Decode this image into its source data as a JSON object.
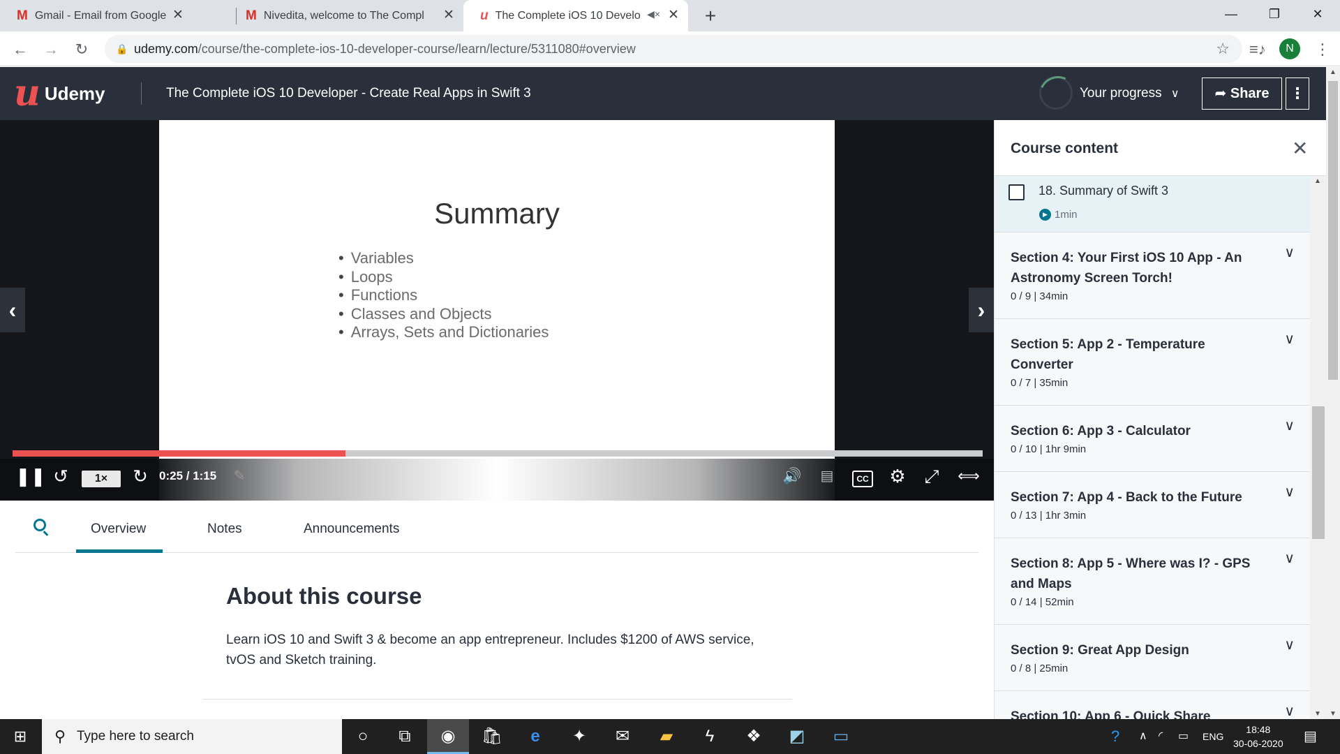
{
  "browser": {
    "tabs": [
      {
        "icon": "gmail-icon",
        "title": "Gmail - Email from Google",
        "active": false
      },
      {
        "icon": "gmail-icon",
        "title": "Nivedita, welcome to The Compl",
        "active": false
      },
      {
        "icon": "udemy-icon",
        "title": "The Complete iOS 10 Develo",
        "active": true
      }
    ],
    "new_tab": "+",
    "url_host": "udemy.com",
    "url_path": "/course/the-complete-ios-10-developer-course/learn/lecture/5311080#overview",
    "profile_initial": "N"
  },
  "header": {
    "logo_text": "Udemy",
    "course_title": "The Complete iOS 10 Developer - Create Real Apps in Swift 3",
    "progress_label": "Your progress",
    "share_label": "Share",
    "more": "⋮"
  },
  "player": {
    "slide_title": "Summary",
    "bullets": [
      "Variables",
      "Loops",
      "Functions",
      "Classes and Objects",
      "Arrays, Sets and Dictionaries"
    ],
    "speed": "1×",
    "time": "0:25 / 1:15",
    "progress": 0.343,
    "cc": "CC"
  },
  "tabs": {
    "items": [
      "Overview",
      "Notes",
      "Announcements"
    ],
    "active": "Overview"
  },
  "about": {
    "title": "About this course",
    "text": "Learn iOS 10 and Swift 3 & become an app entrepreneur. Includes $1200 of AWS service, tvOS and Sketch training."
  },
  "sidebar": {
    "title": "Course content",
    "current_lecture": {
      "title": "18. Summary of Swift 3",
      "duration": "1min"
    },
    "sections": [
      {
        "title": "Section 4: Your First iOS 10 App - An Astronomy Screen Torch!",
        "meta": "0 / 9 | 34min"
      },
      {
        "title": "Section 5: App 2 - Temperature Converter",
        "meta": "0 / 7 | 35min"
      },
      {
        "title": "Section 6: App 3 - Calculator",
        "meta": "0 / 10 | 1hr 9min"
      },
      {
        "title": "Section 7: App 4 - Back to the Future",
        "meta": "0 / 13 | 1hr 3min"
      },
      {
        "title": "Section 8: App 5 - Where was I? - GPS and Maps",
        "meta": "0 / 14 | 52min"
      },
      {
        "title": "Section 9: Great App Design",
        "meta": "0 / 8 | 25min"
      },
      {
        "title": "Section 10: App 6 - Quick Share",
        "meta": ""
      }
    ]
  },
  "taskbar": {
    "search_placeholder": "Type here to search",
    "lang": "ENG",
    "time": "18:48",
    "date": "30-06-2020"
  },
  "colors": {
    "accent": "#ec5252",
    "header_bg": "#29303b",
    "teal": "#007791"
  }
}
